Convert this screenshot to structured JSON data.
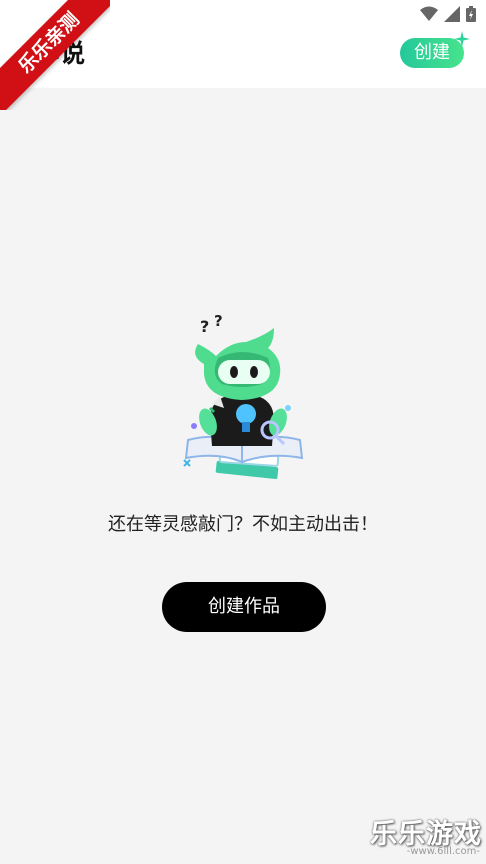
{
  "header": {
    "title": "小说",
    "create_label": "创建"
  },
  "watermark": {
    "ribbon_text": "乐乐亲测",
    "corner_text": "乐乐游戏",
    "corner_url": "-www.6lll.com-"
  },
  "empty_state": {
    "message": "还在等灵感敲门？不如主动出击！",
    "button_label": "创建作品"
  },
  "colors": {
    "accent_green": "#24c89b",
    "button_black": "#000000",
    "background": "#f4f4f4"
  }
}
